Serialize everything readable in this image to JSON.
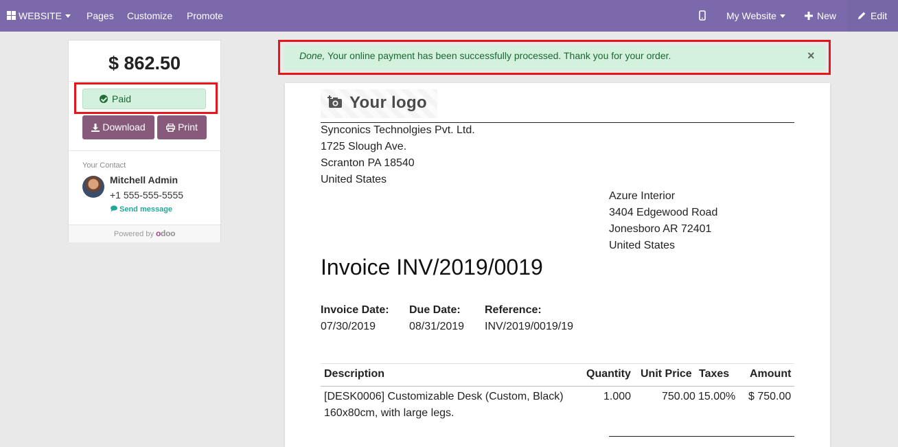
{
  "navbar": {
    "app_label": "WEBSITE",
    "menu": [
      "Pages",
      "Customize",
      "Promote"
    ],
    "website_label": "My Website",
    "new_label": "New",
    "edit_label": "Edit",
    "bg_color": "#7c69ac"
  },
  "sidebar": {
    "amount": "$ 862.50",
    "status": "Paid",
    "download_label": "Download",
    "print_label": "Print",
    "contact_title": "Your Contact",
    "contact_name": "Mitchell Admin",
    "contact_phone": "+1 555-555-5555",
    "send_message_label": "Send message",
    "powered_by": "Powered by",
    "brand": "odoo"
  },
  "alert": {
    "emphasis": "Done,",
    "message": "Your online payment has been successfully processed. Thank you for your order.",
    "close_symbol": "×"
  },
  "invoice": {
    "logo_text": "Your logo",
    "company": {
      "name": "Synconics Technolgies Pvt. Ltd.",
      "street": "1725 Slough Ave.",
      "city": "Scranton PA 18540",
      "country": "United States"
    },
    "customer": {
      "name": "Azure Interior",
      "street": "3404 Edgewood Road",
      "city": "Jonesboro AR 72401",
      "country": "United States"
    },
    "title": "Invoice INV/2019/0019",
    "info": [
      {
        "label": "Invoice Date:",
        "value": "07/30/2019"
      },
      {
        "label": "Due Date:",
        "value": "08/31/2019"
      },
      {
        "label": "Reference:",
        "value": "INV/2019/0019/19"
      }
    ],
    "table": {
      "headers": [
        "Description",
        "Quantity",
        "Unit Price",
        "Taxes",
        "Amount"
      ],
      "rows": [
        {
          "description_line1": "[DESK0006] Customizable Desk (Custom, Black)",
          "description_line2": "160x80cm, with large legs.",
          "quantity": "1.000",
          "unit_price": "750.00",
          "taxes": "15.00%",
          "amount": "$ 750.00"
        }
      ]
    }
  },
  "colors": {
    "primary_button": "#875a7b",
    "success_bg": "#d4f1dd",
    "success_text": "#186633",
    "highlight_border": "#e8141c",
    "link": "#21a89b"
  }
}
